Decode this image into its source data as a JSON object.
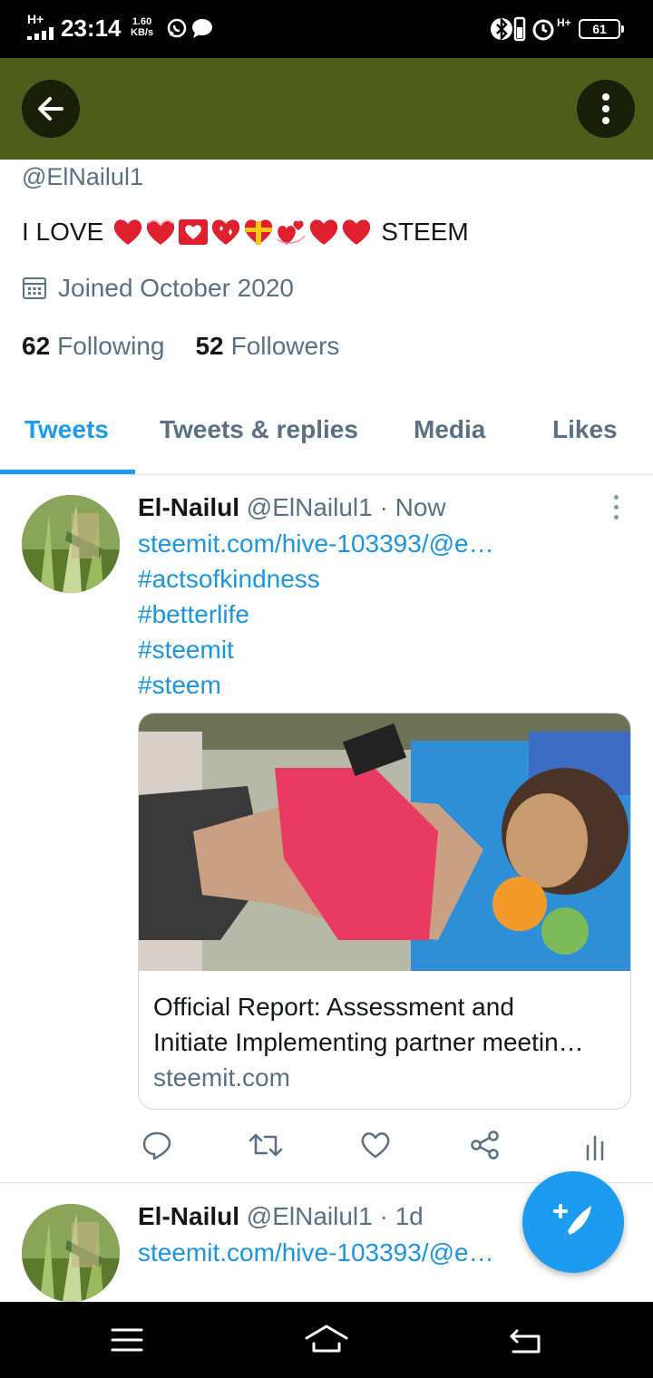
{
  "status_bar": {
    "network": "H+",
    "time": "23:14",
    "speed_value": "1.60",
    "speed_unit": "KB/s",
    "network2": "H+",
    "battery": "61",
    "icons": [
      "whatsapp-icon",
      "chat-bubble-icon",
      "bluetooth-icon",
      "vibrate-icon",
      "alarm-icon",
      "signal-icon",
      "battery-icon"
    ]
  },
  "app_bar": {
    "accent": "#4e5d1a",
    "icons": [
      "back-arrow-icon",
      "more-vertical-icon"
    ]
  },
  "profile": {
    "handle": "@ElNailul1",
    "bio_prefix": "I LOVE",
    "bio_suffix": "STEEM",
    "bio_emojis": [
      "red-heart",
      "heart-ribbon",
      "heart-letter",
      "sparkling-heart",
      "gift-heart",
      "revolving-hearts",
      "red-heart",
      "red-heart"
    ],
    "joined": "Joined October 2020",
    "following_count": "62",
    "following_label": "Following",
    "followers_count": "52",
    "followers_label": "Followers"
  },
  "tabs": [
    {
      "label": "Tweets",
      "active": true
    },
    {
      "label": "Tweets & replies",
      "active": false
    },
    {
      "label": "Media",
      "active": false
    },
    {
      "label": "Likes",
      "active": false
    }
  ],
  "tweets": [
    {
      "name": "El-Nailul",
      "handle": "@ElNailul1",
      "time": "· Now",
      "links": [
        "steemit.com/hive-103393/@e…",
        "#actsofkindness",
        "#betterlife",
        "#steemit",
        "#steem"
      ],
      "card": {
        "title_line1": "Official Report: Assessment and",
        "title_line2": "Initiate Implementing partner meetin…",
        "domain": "steemit.com"
      }
    },
    {
      "name": "El-Nailul",
      "handle": "@ElNailul1",
      "time": "· 1d",
      "links": [
        "steemit.com/hive-103393/@e…"
      ]
    }
  ],
  "colors": {
    "link": "#1b95e0",
    "primary": "#1d9bf0",
    "secondary_text": "#5b7083"
  }
}
